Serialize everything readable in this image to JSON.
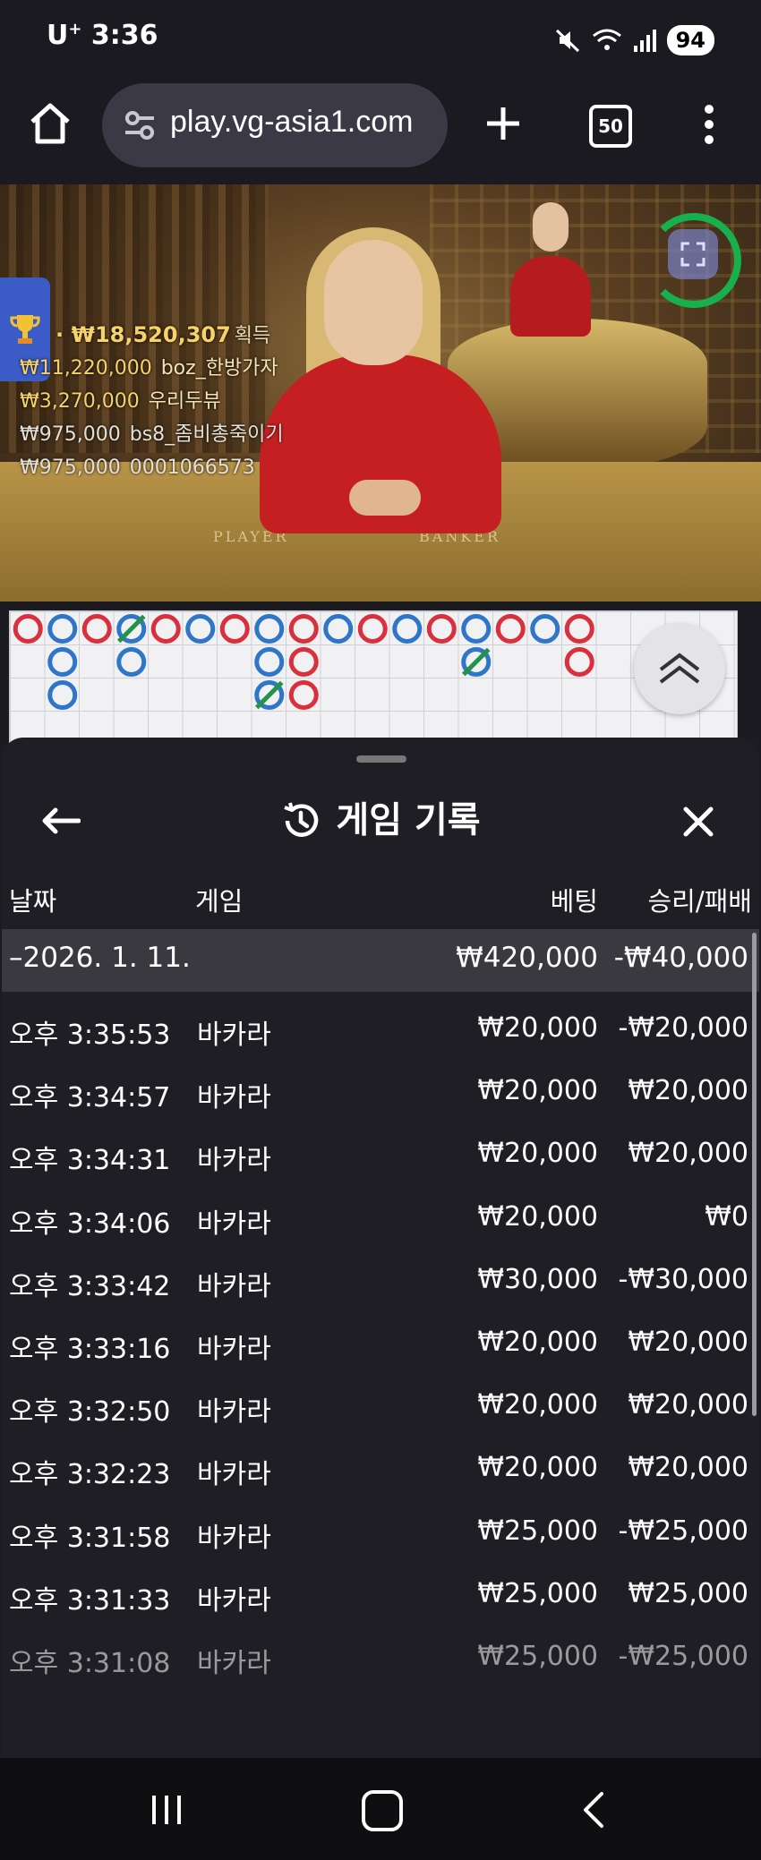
{
  "status_bar": {
    "carrier": "U",
    "carrier_sup": "+",
    "time": "3:36",
    "battery": "94"
  },
  "browser": {
    "url": "play.vg-asia1.com",
    "tab_count": "50"
  },
  "video": {
    "table_label_left": "PLAYER",
    "table_label_right": "BANKER",
    "top_winner": {
      "amount": "₩18,520,307",
      "label": "획득"
    },
    "winners": [
      {
        "amount": "₩11,220,000",
        "name": "boz_한방가자"
      },
      {
        "amount": "₩3,270,000",
        "name": "우리두뷰"
      },
      {
        "amount": "₩975,000",
        "name": "bs8_좀비총죽이기"
      },
      {
        "amount": "₩975,000",
        "name": "0001066573"
      }
    ]
  },
  "roadmap": {
    "colors": {
      "banker": "#d9303d",
      "player": "#2f75c8",
      "tie": "#23924a"
    },
    "cells": [
      {
        "col": 0,
        "row": 0,
        "type": "banker"
      },
      {
        "col": 1,
        "row": 0,
        "type": "player"
      },
      {
        "col": 1,
        "row": 1,
        "type": "player"
      },
      {
        "col": 1,
        "row": 2,
        "type": "player"
      },
      {
        "col": 2,
        "row": 0,
        "type": "banker"
      },
      {
        "col": 3,
        "row": 0,
        "type": "player",
        "tie": true
      },
      {
        "col": 3,
        "row": 1,
        "type": "player"
      },
      {
        "col": 4,
        "row": 0,
        "type": "banker"
      },
      {
        "col": 5,
        "row": 0,
        "type": "player"
      },
      {
        "col": 6,
        "row": 0,
        "type": "banker"
      },
      {
        "col": 7,
        "row": 0,
        "type": "player"
      },
      {
        "col": 7,
        "row": 1,
        "type": "player"
      },
      {
        "col": 7,
        "row": 2,
        "type": "player",
        "tie": true
      },
      {
        "col": 8,
        "row": 0,
        "type": "banker"
      },
      {
        "col": 8,
        "row": 1,
        "type": "banker"
      },
      {
        "col": 8,
        "row": 2,
        "type": "banker"
      },
      {
        "col": 9,
        "row": 0,
        "type": "player"
      },
      {
        "col": 10,
        "row": 0,
        "type": "banker"
      },
      {
        "col": 11,
        "row": 0,
        "type": "player"
      },
      {
        "col": 12,
        "row": 0,
        "type": "banker"
      },
      {
        "col": 13,
        "row": 0,
        "type": "player"
      },
      {
        "col": 13,
        "row": 1,
        "type": "player",
        "tie": true
      },
      {
        "col": 14,
        "row": 0,
        "type": "banker"
      },
      {
        "col": 15,
        "row": 0,
        "type": "player"
      },
      {
        "col": 16,
        "row": 0,
        "type": "banker"
      },
      {
        "col": 16,
        "row": 1,
        "type": "banker"
      }
    ]
  },
  "sheet": {
    "title": "게임 기록",
    "columns": {
      "date": "날짜",
      "game": "게임",
      "bet": "베팅",
      "result": "승리/패배"
    },
    "summary": {
      "date": "–2026. 1. 11.",
      "bet": "₩420,000",
      "result": "-₩40,000"
    },
    "rows": [
      {
        "time": "오후 3:35:53",
        "game": "바카라",
        "bet": "₩20,000",
        "result": "-₩20,000"
      },
      {
        "time": "오후 3:34:57",
        "game": "바카라",
        "bet": "₩20,000",
        "result": "₩20,000"
      },
      {
        "time": "오후 3:34:31",
        "game": "바카라",
        "bet": "₩20,000",
        "result": "₩20,000"
      },
      {
        "time": "오후 3:34:06",
        "game": "바카라",
        "bet": "₩20,000",
        "result": "₩0"
      },
      {
        "time": "오후 3:33:42",
        "game": "바카라",
        "bet": "₩30,000",
        "result": "-₩30,000"
      },
      {
        "time": "오후 3:33:16",
        "game": "바카라",
        "bet": "₩20,000",
        "result": "₩20,000"
      },
      {
        "time": "오후 3:32:50",
        "game": "바카라",
        "bet": "₩20,000",
        "result": "₩20,000"
      },
      {
        "time": "오후 3:32:23",
        "game": "바카라",
        "bet": "₩20,000",
        "result": "₩20,000"
      },
      {
        "time": "오후 3:31:58",
        "game": "바카라",
        "bet": "₩25,000",
        "result": "-₩25,000"
      },
      {
        "time": "오후 3:31:33",
        "game": "바카라",
        "bet": "₩25,000",
        "result": "₩25,000"
      },
      {
        "time": "오후 3:31:08",
        "game": "바카라",
        "bet": "₩25,000",
        "result": "-₩25,000"
      }
    ]
  }
}
